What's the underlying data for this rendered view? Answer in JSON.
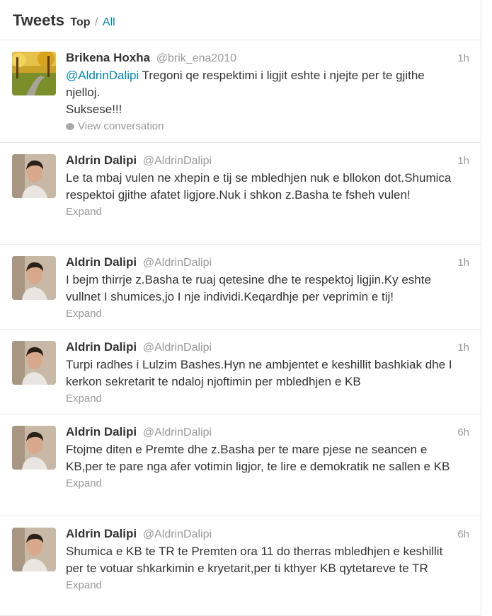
{
  "header": {
    "title": "Tweets",
    "filter_top": "Top",
    "separator": "/",
    "filter_all": "All"
  },
  "tweets": [
    {
      "name": "Brikena Hoxha",
      "handle": "@brik_ena2010",
      "time": "1h",
      "mention": "@AldrinDalipi",
      "line1": " Tregoni qe respektimi i ligjit eshte i njejte per te gjithe njelloj.",
      "line2": "Suksese!!!",
      "action": "View conversation"
    },
    {
      "name": "Aldrin Dalipi",
      "handle": "@AldrinDalipi",
      "time": "1h",
      "text": "Le ta mbaj vulen ne xhepin e tij se mbledhjen nuk e bllokon dot.Shumica respektoi gjithe afatet ligjore.Nuk i shkon z.Basha te fsheh vulen!",
      "action": "Expand"
    },
    {
      "name": "Aldrin Dalipi",
      "handle": "@AldrinDalipi",
      "time": "1h",
      "text": "I bejm thirrje z.Basha te ruaj qetesine dhe te respektoj ligjin.Ky eshte vullnet I shumices,jo I nje individi.Keqardhje per veprimin e tij!",
      "action": "Expand"
    },
    {
      "name": "Aldrin Dalipi",
      "handle": "@AldrinDalipi",
      "time": "1h",
      "text": "Turpi radhes i Lulzim Bashes.Hyn ne ambjentet e keshillit bashkiak dhe I kerkon sekretarit te ndaloj njoftimin per mbledhjen e KB",
      "action": "Expand"
    },
    {
      "name": "Aldrin Dalipi",
      "handle": "@AldrinDalipi",
      "time": "6h",
      "text": "Ftojme diten e Premte dhe z.Basha per te mare pjese ne seancen e KB,per te pare nga afer votimin ligjor, te lire e demokratik ne sallen e KB",
      "action": "Expand"
    },
    {
      "name": "Aldrin Dalipi",
      "handle": "@AldrinDalipi",
      "time": "6h",
      "text": "Shumica e KB te TR te Premten ora 11 do therras mbledhjen e keshillit per te votuar shkarkimin e kryetarit,per ti kthyer KB qytetareve te TR",
      "action": "Expand"
    }
  ],
  "colors": {
    "link": "#0084b4",
    "muted": "#999999",
    "text": "#333333",
    "border": "#e8e8e8"
  }
}
